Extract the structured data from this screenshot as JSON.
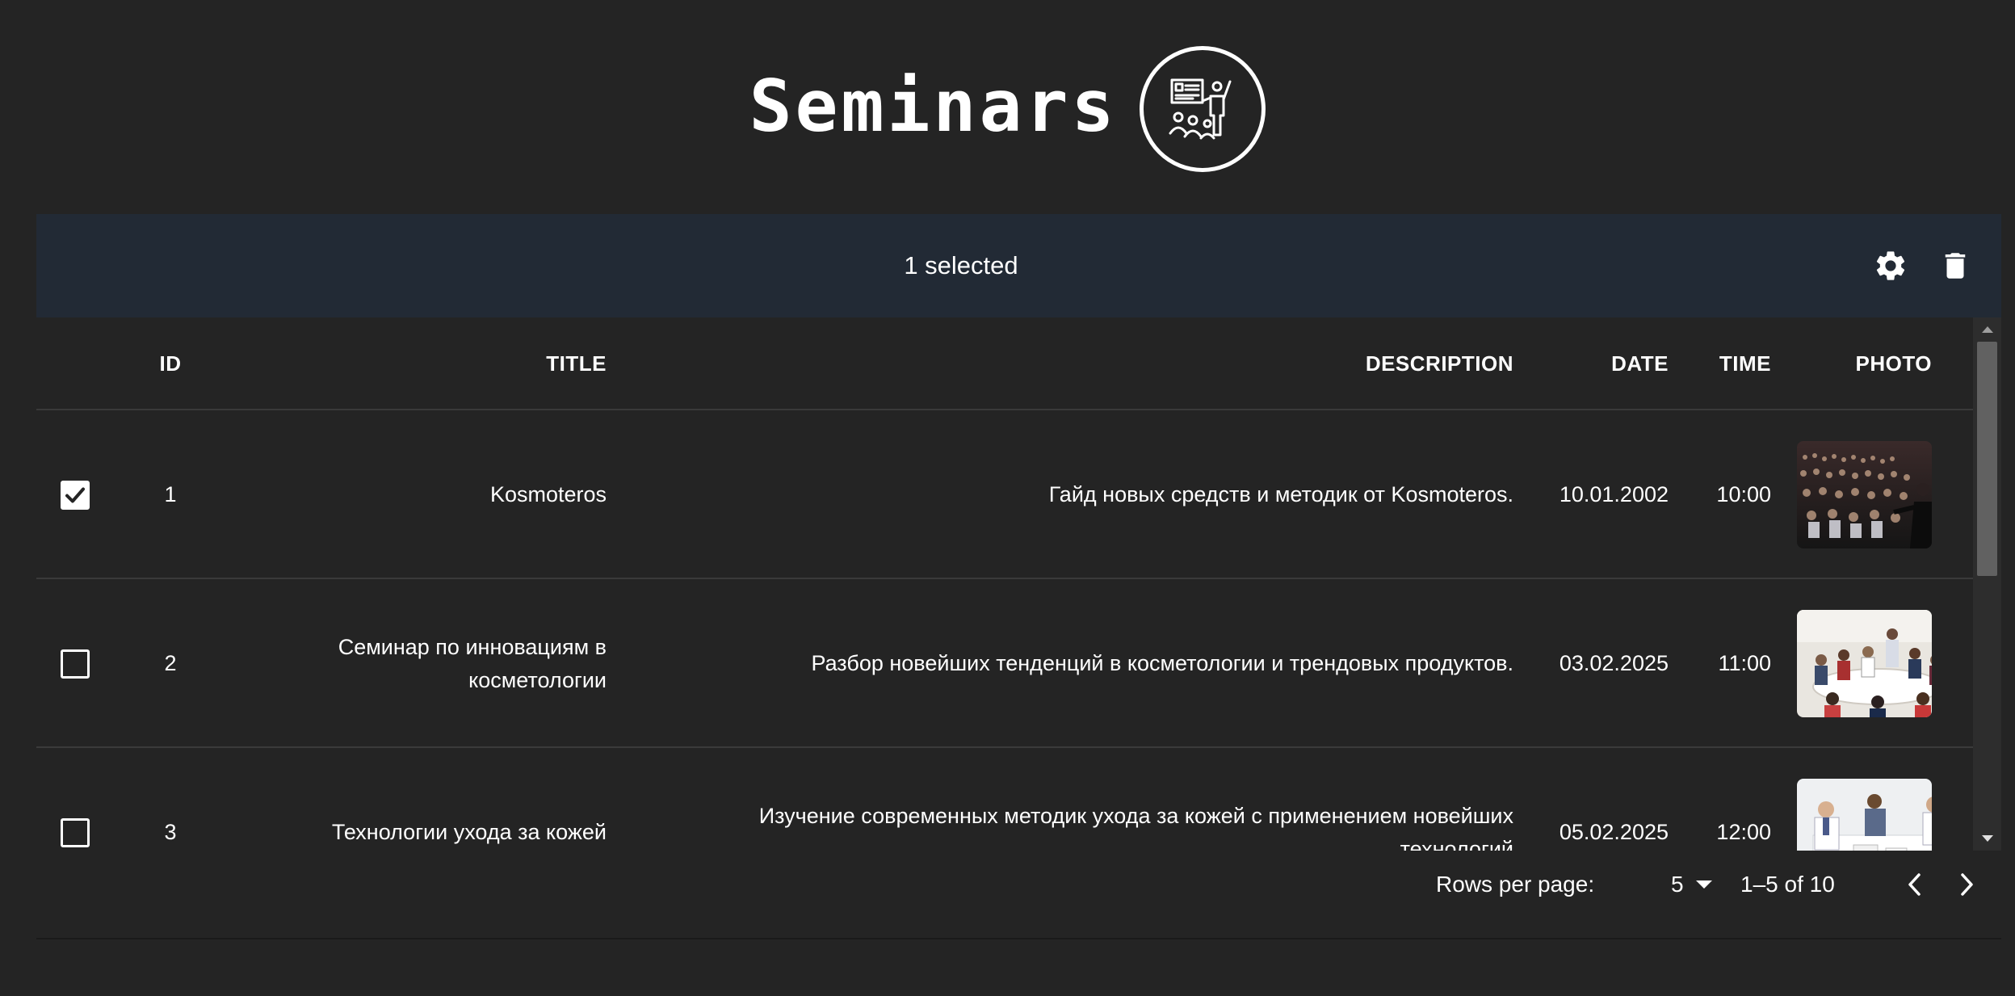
{
  "header": {
    "title": "Seminars",
    "logo_icon": "presenter-audience-icon"
  },
  "toolbar": {
    "selected_label": "1 selected",
    "settings_icon": "gear-icon",
    "delete_icon": "trash-icon",
    "background": "#222a35"
  },
  "table": {
    "columns": {
      "id": "ID",
      "title": "TITLE",
      "description": "DESCRIPTION",
      "date": "DATE",
      "time": "TIME",
      "photo": "PHOTO"
    },
    "rows": [
      {
        "checked": true,
        "id": "1",
        "title": "Kosmoteros",
        "description": "Гайд новых средств и методик от Kosmoteros.",
        "date": "10.01.2002",
        "time": "10:00",
        "photo_icon": "conference-crowd-photo"
      },
      {
        "checked": false,
        "id": "2",
        "title_line1": "Семинар по инновациям в",
        "title_line2": "косметологии",
        "description": "Разбор новейших тенденций в косметологии и трендовых продуктов.",
        "date": "03.02.2025",
        "time": "11:00",
        "photo_icon": "meeting-table-photo"
      },
      {
        "checked": false,
        "id": "3",
        "title": "Технологии ухода за кожей",
        "description_line1": "Изучение современных методик ухода за кожей с применением новейших",
        "description_line2": "технологий",
        "date": "05.02.2025",
        "time": "12:00",
        "photo_icon": "business-discussion-photo"
      }
    ]
  },
  "pagination": {
    "rows_per_page_label": "Rows per page:",
    "rows_per_page_value": "5",
    "range_label": "1–5 of 10",
    "prev_icon": "chevron-left-icon",
    "next_icon": "chevron-right-icon"
  }
}
